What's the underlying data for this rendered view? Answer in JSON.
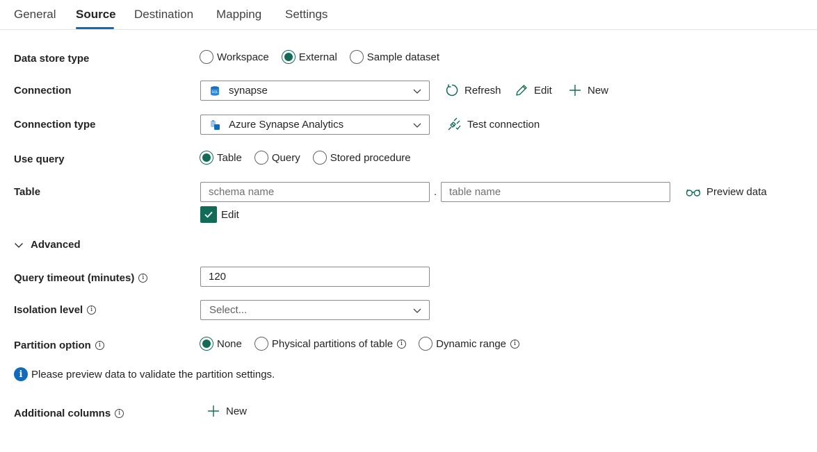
{
  "tabs": [
    {
      "label": "General"
    },
    {
      "label": "Source"
    },
    {
      "label": "Destination"
    },
    {
      "label": "Mapping"
    },
    {
      "label": "Settings"
    }
  ],
  "active_tab": "Source",
  "data_store_type": {
    "label": "Data store type",
    "options": [
      "Workspace",
      "External",
      "Sample dataset"
    ],
    "selected": "External"
  },
  "connection": {
    "label": "Connection",
    "value": "synapse",
    "refresh": "Refresh",
    "edit": "Edit",
    "new": "New"
  },
  "connection_type": {
    "label": "Connection type",
    "value": "Azure Synapse Analytics",
    "test": "Test connection"
  },
  "use_query": {
    "label": "Use query",
    "options": [
      "Table",
      "Query",
      "Stored procedure"
    ],
    "selected": "Table"
  },
  "table": {
    "label": "Table",
    "schema_placeholder": "schema name",
    "separator": ".",
    "table_placeholder": "table name",
    "preview": "Preview data",
    "edit_checkbox": "Edit",
    "edit_checked": true
  },
  "advanced": {
    "label": "Advanced"
  },
  "query_timeout": {
    "label": "Query timeout (minutes)",
    "value": "120"
  },
  "isolation_level": {
    "label": "Isolation level",
    "placeholder": "Select..."
  },
  "partition_option": {
    "label": "Partition option",
    "options": [
      "None",
      "Physical partitions of table",
      "Dynamic range"
    ],
    "selected": "None"
  },
  "notice": {
    "text": "Please preview data to validate the partition settings."
  },
  "additional_columns": {
    "label": "Additional columns",
    "new": "New"
  },
  "colors": {
    "accent": "#116b56",
    "tab_underline": "#0f6cbd",
    "info": "#0f6cbd"
  }
}
